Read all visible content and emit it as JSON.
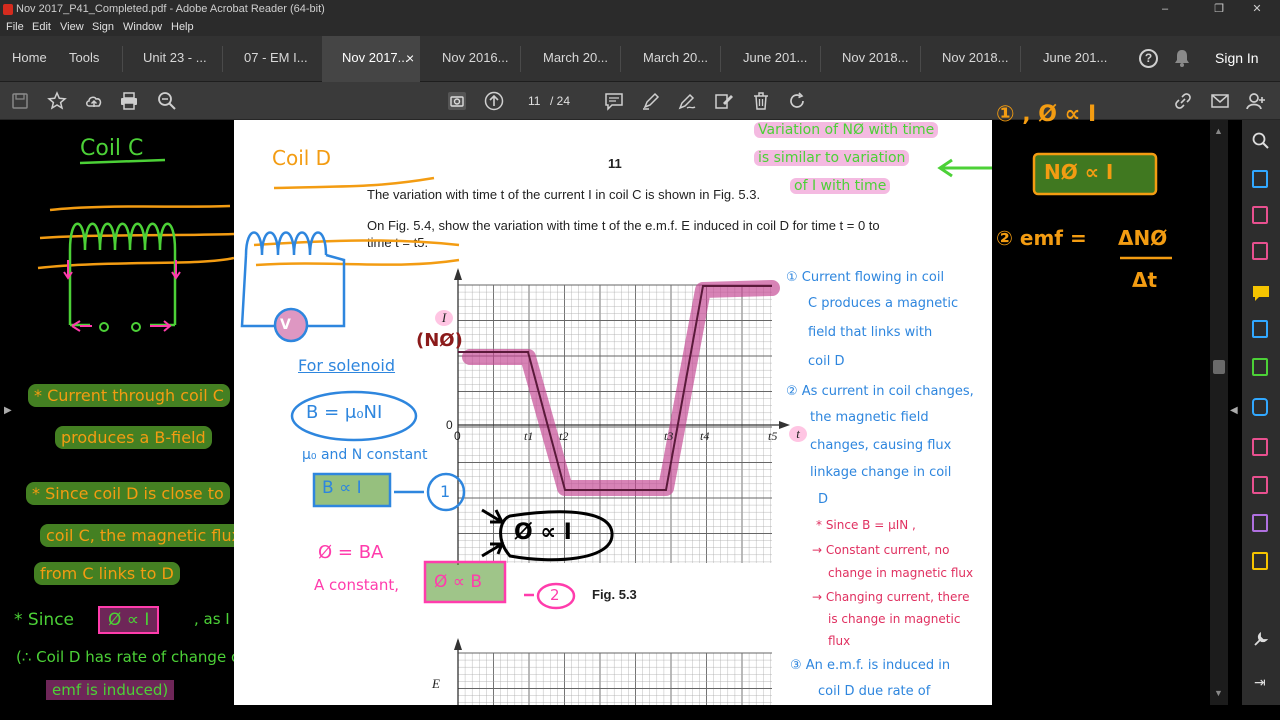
{
  "window": {
    "title": "Nov 2017_P41_Completed.pdf - Adobe Acrobat Reader (64-bit)",
    "controls": [
      "–",
      "❐",
      "✕"
    ]
  },
  "menu": [
    "File",
    "Edit",
    "View",
    "Sign",
    "Window",
    "Help"
  ],
  "tabs": {
    "home": "Home",
    "tools": "Tools",
    "docs": [
      "Unit 23 - ...",
      "07 - EM I...",
      "Nov 2017...",
      "Nov 2016...",
      "March 20...",
      "March 20...",
      "June 201...",
      "Nov 2018...",
      "Nov 2018...",
      "June 201..."
    ],
    "active_index": 2,
    "close": "×",
    "help": "?",
    "signin": "Sign In"
  },
  "toolbar": {
    "page_current": "11",
    "page_total": "/ 24"
  },
  "page": {
    "page_number": "11",
    "line1": "The variation with time t of the current I in coil C is shown in Fig. 5.3.",
    "line2": "On Fig. 5.4, show the variation with time t of the e.m.f. E induced in coil D for time t = 0 to",
    "line3": "time t = t5.",
    "fig_caption": "Fig. 5.3",
    "axis_I": "I",
    "axis_E": "E",
    "zero_y": "0",
    "zero_x": "0",
    "ticks": [
      "t1",
      "t2",
      "t3",
      "t4",
      "t5"
    ],
    "axis_t": "t"
  },
  "notes_left": {
    "coil_c": "Coil C",
    "n1": "* Current through coil C",
    "n1b": "produces a B-field",
    "n2": "* Since coil D is close to",
    "n2b": "coil C, the magnetic flux",
    "n2c": "from C links to D",
    "n3a": "* Since",
    "n3box": "Ø ∝ I",
    "n3b": ", as I changes, Ø changes",
    "n4": "(∴ Coil D has rate of change of flux linkage",
    "n4b": "emf is induced)"
  },
  "notes_page": {
    "coil_d": "Coil D",
    "for_solenoid": "For solenoid",
    "b_eq": "B = μ₀NI",
    "const": "μ₀ and N constant",
    "b_prop": "B ∝ I",
    "circle1": "1",
    "phi_eq": "Ø = BA",
    "a_const": "A constant,",
    "phi_b": "Ø ∝ B",
    "circle2": "2",
    "phi_i": "Ø ∝ I",
    "nphi": "(NØ)",
    "variation1": "Variation of NØ with time",
    "variation2": "is similar to variation",
    "variation3": "of I with time",
    "r1": "① Current flowing in coil",
    "r1b": "C produces a magnetic",
    "r1c": "field that links with",
    "r1d": "coil D",
    "r2": "② As current in coil changes,",
    "r2b": "the magnetic field",
    "r2c": "changes, causing flux",
    "r2d": "linkage change in coil",
    "r2e": "D",
    "r3": "* Since  B = μIN ,",
    "r3b": "→ Constant current, no",
    "r3c": "change in magnetic flux",
    "r3d": "→ Changing current, there",
    "r3e": "is change in magnetic",
    "r3f": "flux",
    "r4": "③ An e.m.f. is induced in",
    "r4b": "coil D due rate of"
  },
  "notes_right": {
    "eq1": "① , Ø ∝ I",
    "eq1box": "NØ ∝ I",
    "eq2": "② emf =",
    "eq2num": "ΔNØ",
    "eq2den": "Δt"
  },
  "colors": {
    "green": "#4cd137",
    "orange": "#f39c12",
    "pink": "#ff3cac",
    "blue": "#2e86de",
    "darkred": "#8b1a1a",
    "hl_green": "#4a8f2a",
    "hl_pink": "#c2418f"
  }
}
